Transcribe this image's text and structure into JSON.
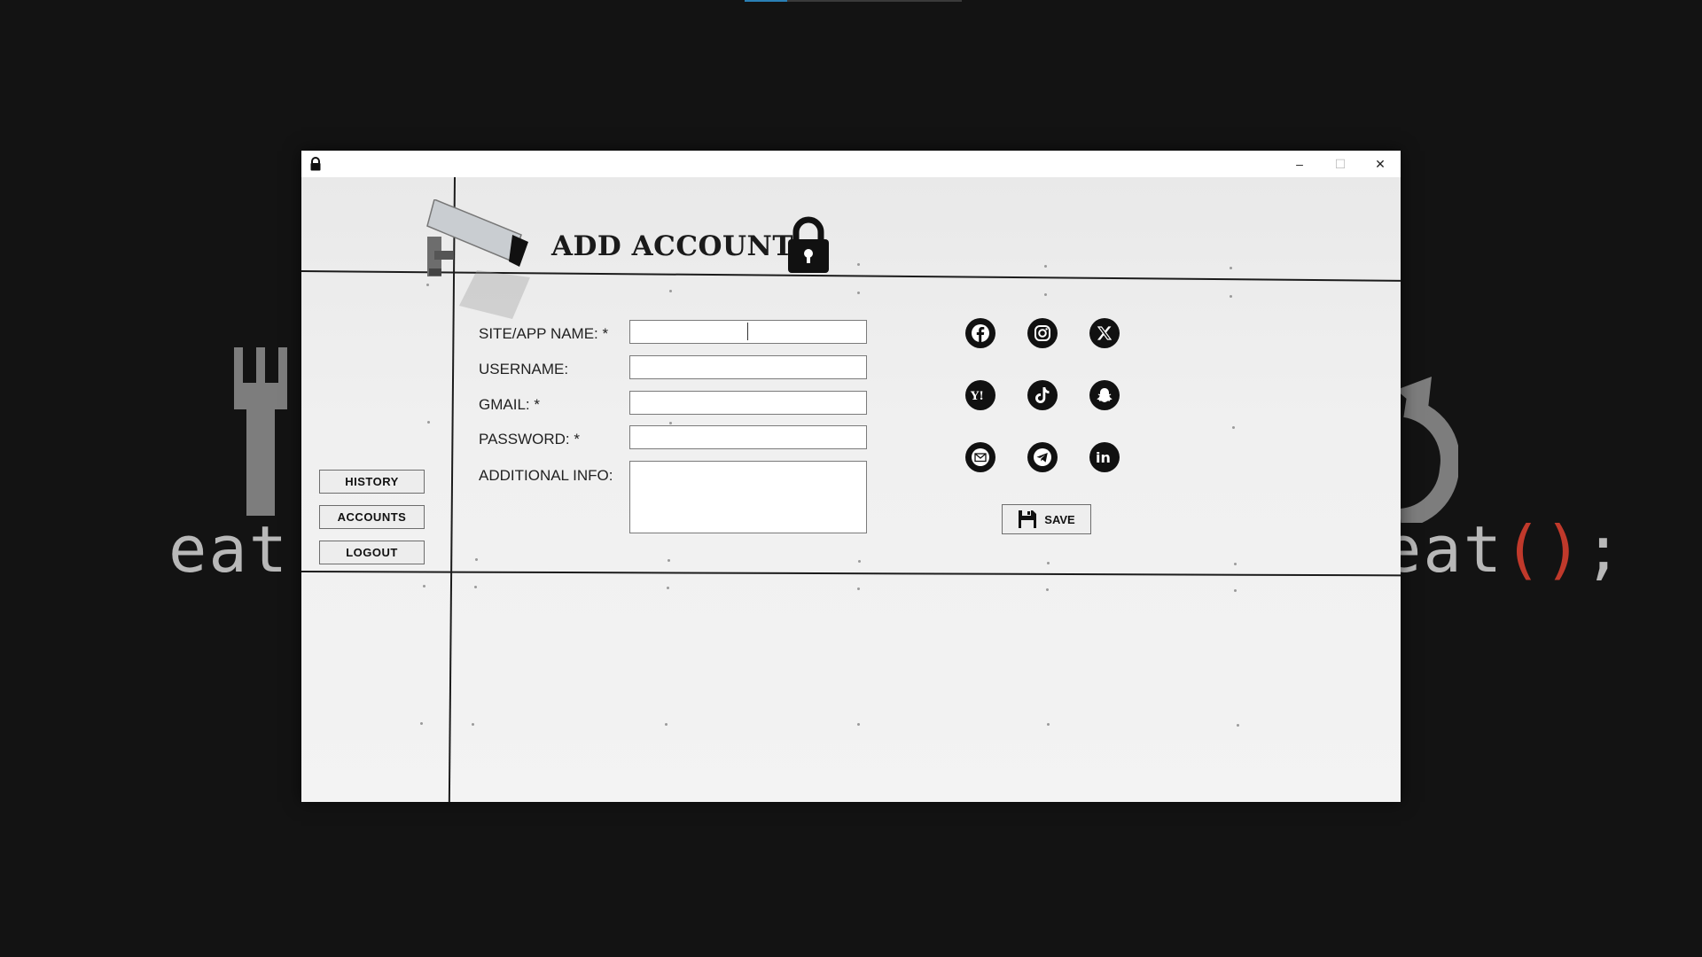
{
  "wallpaper": {
    "left_text": "eat",
    "right_text_main": "eat",
    "right_text_paren": "()",
    "right_text_end": ";"
  },
  "window": {
    "controls": {
      "minimize": "–",
      "maximize": "☐",
      "close": "✕"
    }
  },
  "header": {
    "title": "ADD ACCOUNT"
  },
  "form": {
    "site_label": "SITE/APP NAME: *",
    "username_label": "USERNAME:",
    "gmail_label": "GMAIL: *",
    "password_label": "PASSWORD: *",
    "additional_label": "ADDITIONAL INFO:",
    "site_value": "",
    "username_value": "",
    "gmail_value": "",
    "password_value": "",
    "additional_value": ""
  },
  "nav": {
    "history": "HISTORY",
    "accounts": "ACCOUNTS",
    "logout": "LOGOUT"
  },
  "socials": [
    {
      "icon": "facebook-icon"
    },
    {
      "icon": "instagram-icon"
    },
    {
      "icon": "x-icon"
    },
    {
      "icon": "yahoo-icon",
      "glyph": "Y!"
    },
    {
      "icon": "tiktok-icon"
    },
    {
      "icon": "snapchat-icon"
    },
    {
      "icon": "email-icon"
    },
    {
      "icon": "telegram-icon"
    },
    {
      "icon": "linkedin-icon",
      "glyph": "in"
    }
  ],
  "actions": {
    "save": "SAVE"
  },
  "colors": {
    "background": "#131313",
    "window": "#ffffff",
    "icon": "#111111",
    "accent": "#2a7fb5",
    "wallpaper_paren": "#c0392b"
  }
}
